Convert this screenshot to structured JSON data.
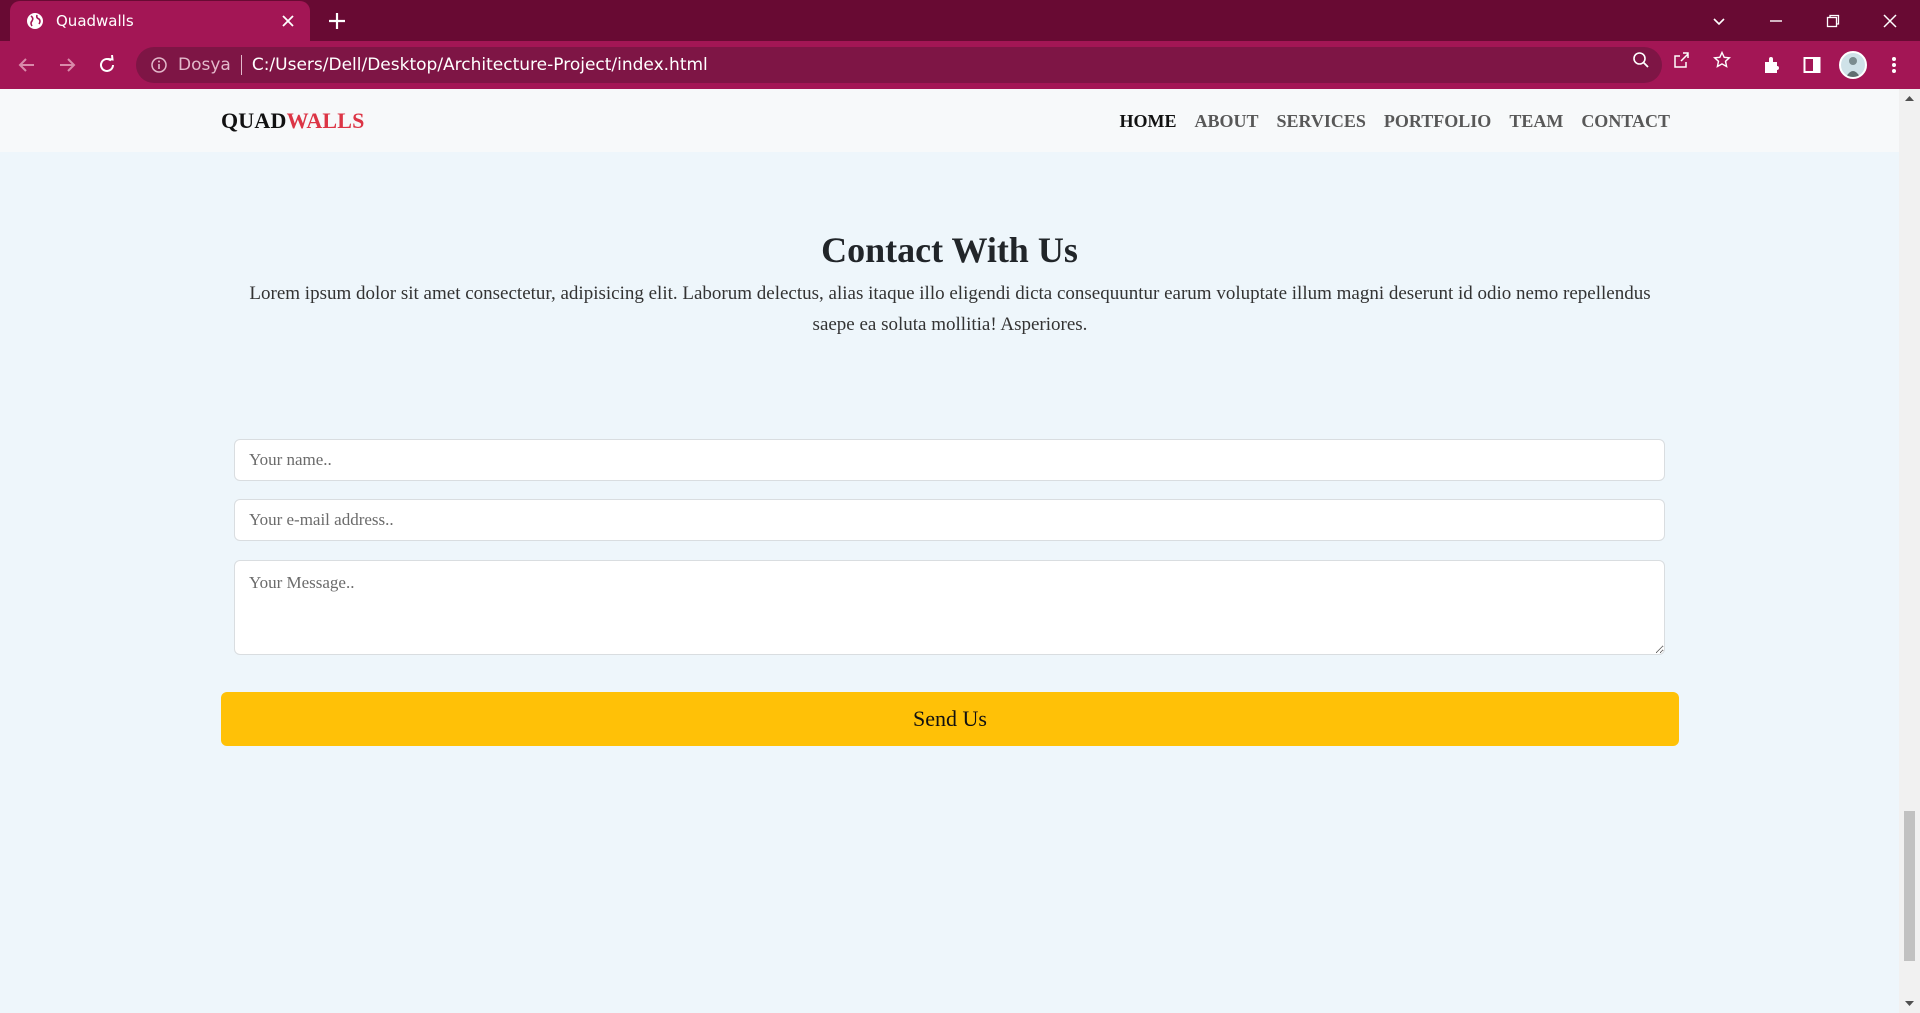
{
  "browser": {
    "tab_title": "Quadwalls",
    "site_label": "Dosya",
    "url": "C:/Users/Dell/Desktop/Architecture-Project/index.html",
    "colors": {
      "tabbar": "#680a33",
      "toolbar": "#a31655",
      "omnibox": "#7e1545"
    }
  },
  "site": {
    "brand_part1": "QUAD",
    "brand_part2": "WALLS",
    "nav": [
      {
        "label": "HOME",
        "active": true
      },
      {
        "label": "ABOUT"
      },
      {
        "label": "SERVICES"
      },
      {
        "label": "PORTFOLIO"
      },
      {
        "label": "TEAM"
      },
      {
        "label": "CONTACT"
      }
    ]
  },
  "contact": {
    "title": "Contact With Us",
    "text": "Lorem ipsum dolor sit amet consectetur, adipisicing elit. Laborum delectus, alias itaque illo eligendi dicta consequuntur earum voluptate illum magni deserunt id odio nemo repellendus saepe ea soluta mollitia! Asperiores.",
    "name_placeholder": "Your name..",
    "email_placeholder": "Your e-mail address..",
    "message_placeholder": "Your Message..",
    "submit_label": "Send Us",
    "accent": "#ffc107"
  }
}
